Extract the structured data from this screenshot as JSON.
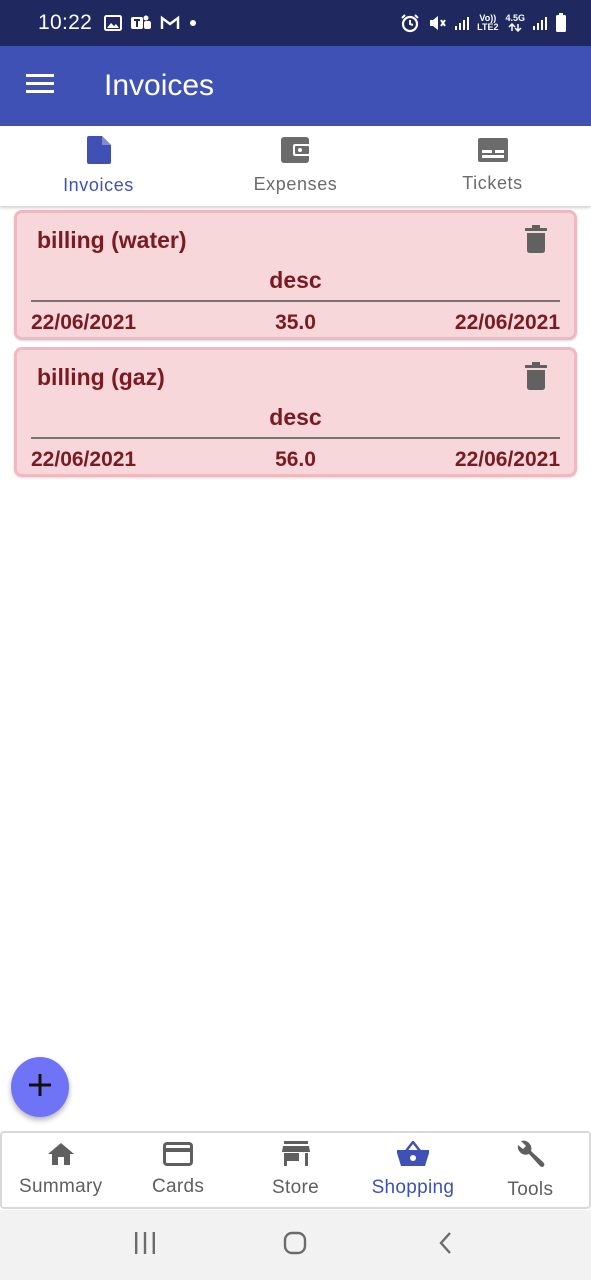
{
  "status_bar": {
    "time": "10:22",
    "network_volte": "Vo))",
    "network_lte": "LTE2",
    "network_45g": "4.5G"
  },
  "app_bar": {
    "title": "Invoices",
    "menu_icon": "hamburger-menu-icon"
  },
  "top_tabs": [
    {
      "label": "Invoices",
      "icon": "document-icon",
      "active": true
    },
    {
      "label": "Expenses",
      "icon": "wallet-icon",
      "active": false
    },
    {
      "label": "Tickets",
      "icon": "ticket-icon",
      "active": false
    }
  ],
  "invoices": [
    {
      "title": "billing (water)",
      "description": "desc",
      "date_start": "22/06/2021",
      "amount": "35.0",
      "date_end": "22/06/2021"
    },
    {
      "title": "billing (gaz)",
      "description": "desc",
      "date_start": "22/06/2021",
      "amount": "56.0",
      "date_end": "22/06/2021"
    }
  ],
  "fab": {
    "icon": "plus-icon"
  },
  "bottom_nav": [
    {
      "label": "Summary",
      "icon": "home-icon",
      "active": false
    },
    {
      "label": "Cards",
      "icon": "credit-card-icon",
      "active": false
    },
    {
      "label": "Store",
      "icon": "store-icon",
      "active": false
    },
    {
      "label": "Shopping",
      "icon": "shopping-basket-icon",
      "active": true
    },
    {
      "label": "Tools",
      "icon": "wrench-icon",
      "active": false
    }
  ],
  "colors": {
    "primary": "#3f51b5",
    "status_bar": "#1f2960",
    "card_background": "#f8d7da",
    "card_text": "#7a1b24",
    "fab": "#6f73f5"
  }
}
